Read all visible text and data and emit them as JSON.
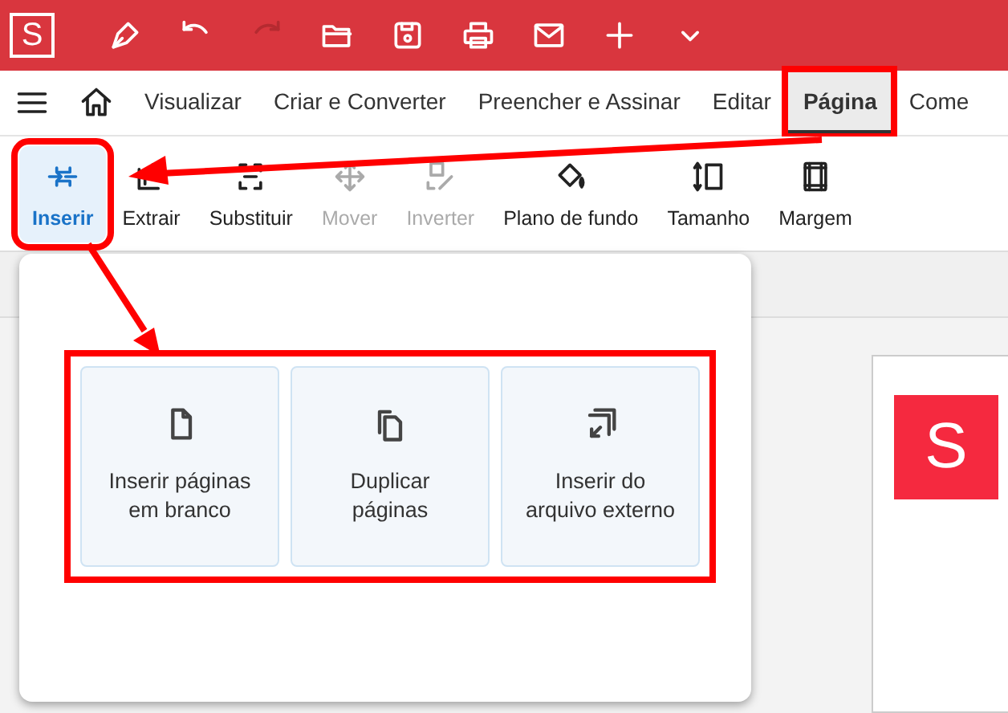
{
  "title_bar": {
    "logo": "S",
    "icons": [
      {
        "kind": "pen",
        "disabled": false
      },
      {
        "kind": "undo",
        "disabled": false
      },
      {
        "kind": "redo",
        "disabled": true
      },
      {
        "kind": "folder",
        "disabled": false
      },
      {
        "kind": "save",
        "disabled": false
      },
      {
        "kind": "print",
        "disabled": false
      },
      {
        "kind": "mail",
        "disabled": false
      },
      {
        "kind": "plus",
        "disabled": false
      },
      {
        "kind": "chevron",
        "disabled": false
      }
    ]
  },
  "menu_tabs": [
    {
      "label": "Visualizar",
      "selected": false,
      "highlighted": false
    },
    {
      "label": "Criar e Converter",
      "selected": false,
      "highlighted": false
    },
    {
      "label": "Preencher e Assinar",
      "selected": false,
      "highlighted": false
    },
    {
      "label": "Editar",
      "selected": false,
      "highlighted": false
    },
    {
      "label": "Página",
      "selected": true,
      "highlighted": true
    },
    {
      "label": "Come",
      "selected": false,
      "highlighted": false
    }
  ],
  "toolbar": [
    {
      "label": "Inserir",
      "kind": "insert",
      "selected": true,
      "disabled": false,
      "highlighted": true
    },
    {
      "label": "Extrair",
      "kind": "extract",
      "selected": false,
      "disabled": false,
      "highlighted": false
    },
    {
      "label": "Substituir",
      "kind": "replace",
      "selected": false,
      "disabled": false,
      "highlighted": false
    },
    {
      "label": "Mover",
      "kind": "move",
      "selected": false,
      "disabled": true,
      "highlighted": false
    },
    {
      "label": "Inverter",
      "kind": "flip",
      "selected": false,
      "disabled": true,
      "highlighted": false
    },
    {
      "label": "Plano de fundo",
      "kind": "background",
      "selected": false,
      "disabled": false,
      "highlighted": false
    },
    {
      "label": "Tamanho",
      "kind": "size",
      "selected": false,
      "disabled": false,
      "highlighted": false
    },
    {
      "label": "Margem",
      "kind": "margin",
      "selected": false,
      "disabled": false,
      "highlighted": false
    }
  ],
  "insert_menu": {
    "highlighted": true,
    "options": [
      {
        "label": "Inserir páginas em branco",
        "kind": "blank"
      },
      {
        "label": "Duplicar páginas",
        "kind": "duplicate"
      },
      {
        "label": "Inserir do arquivo externo",
        "kind": "external"
      }
    ]
  },
  "document": {
    "logo": "S"
  }
}
